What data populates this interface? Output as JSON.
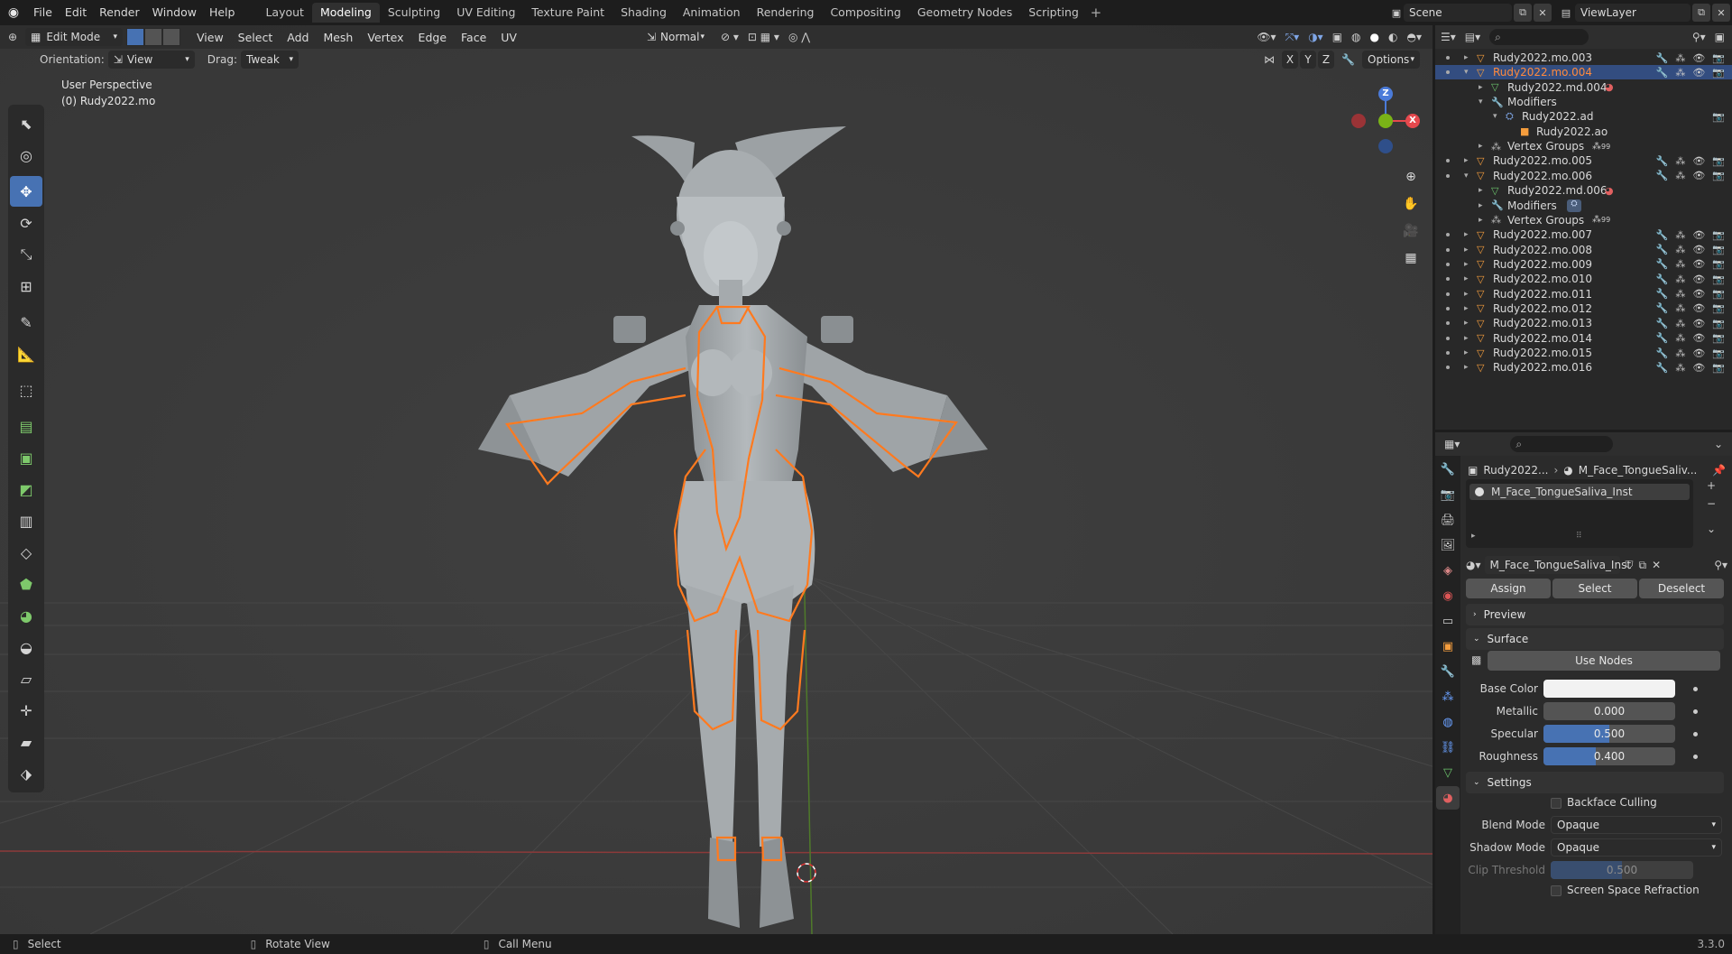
{
  "top_menu": [
    "File",
    "Edit",
    "Render",
    "Window",
    "Help"
  ],
  "workspaces": [
    "Layout",
    "Modeling",
    "Sculpting",
    "UV Editing",
    "Texture Paint",
    "Shading",
    "Animation",
    "Rendering",
    "Compositing",
    "Geometry Nodes",
    "Scripting"
  ],
  "active_workspace": "Modeling",
  "scene": "Scene",
  "view_layer": "ViewLayer",
  "viewport": {
    "mode": "Edit Mode",
    "menus": [
      "View",
      "Select",
      "Add",
      "Mesh",
      "Vertex",
      "Edge",
      "Face",
      "UV"
    ],
    "transform_orientation": "Normal",
    "orientation_label": "Orientation:",
    "orientation_value": "View",
    "drag_label": "Drag:",
    "drag_value": "Tweak",
    "axes": [
      "X",
      "Y",
      "Z"
    ],
    "options_label": "Options",
    "perspective": "User Perspective",
    "object_info": "(0) Rudy2022.mo"
  },
  "gizmo": {
    "z": "Z",
    "x": "X"
  },
  "outliner": {
    "rows": [
      {
        "label": "Rudy2022.mo.003"
      },
      {
        "label": "Rudy2022.mo.004"
      },
      {
        "label": "Rudy2022.md.004"
      },
      {
        "label": "Modifiers"
      },
      {
        "label": "Rudy2022.ad"
      },
      {
        "label": "Rudy2022.ao"
      },
      {
        "label": "Vertex Groups"
      },
      {
        "label": "Rudy2022.mo.005"
      },
      {
        "label": "Rudy2022.mo.006"
      },
      {
        "label": "Rudy2022.md.006"
      },
      {
        "label": "Modifiers"
      },
      {
        "label": "Vertex Groups"
      },
      {
        "label": "Rudy2022.mo.007"
      },
      {
        "label": "Rudy2022.mo.008"
      },
      {
        "label": "Rudy2022.mo.009"
      },
      {
        "label": "Rudy2022.mo.010"
      },
      {
        "label": "Rudy2022.mo.011"
      },
      {
        "label": "Rudy2022.mo.012"
      },
      {
        "label": "Rudy2022.mo.013"
      },
      {
        "label": "Rudy2022.mo.014"
      },
      {
        "label": "Rudy2022.mo.015"
      },
      {
        "label": "Rudy2022.mo.016"
      }
    ],
    "vertex_group_count": "99"
  },
  "properties": {
    "breadcrumb_object": "Rudy2022...",
    "breadcrumb_material": "M_Face_TongueSaliv...",
    "slot_name": "M_Face_TongueSaliva_Inst",
    "material_name": "M_Face_TongueSaliva_Inst",
    "assign": "Assign",
    "select": "Select",
    "deselect": "Deselect",
    "preview_panel": "Preview",
    "surface_panel": "Surface",
    "use_nodes": "Use Nodes",
    "base_color_label": "Base Color",
    "base_color": "#f2f2f2",
    "metallic_label": "Metallic",
    "metallic": "0.000",
    "specular_label": "Specular",
    "specular": "0.500",
    "roughness_label": "Roughness",
    "roughness": "0.400",
    "settings_panel": "Settings",
    "backface_culling": "Backface Culling",
    "blend_mode_label": "Blend Mode",
    "blend_mode": "Opaque",
    "shadow_mode_label": "Shadow Mode",
    "shadow_mode": "Opaque",
    "clip_threshold_label": "Clip Threshold",
    "clip_threshold": "0.500",
    "screen_space_refraction": "Screen Space Refraction"
  },
  "status_bar": {
    "select": "Select",
    "rotate_view": "Rotate View",
    "call_menu": "Call Menu",
    "version": "3.3.0"
  },
  "colors": {
    "accent": "#4772b3",
    "selection_outline": "#ff7a1f",
    "active_object_text": "#ff8a3d",
    "x_axis": "#e5484d",
    "y_axis": "#7ab317",
    "z_axis": "#4b7bd9"
  }
}
